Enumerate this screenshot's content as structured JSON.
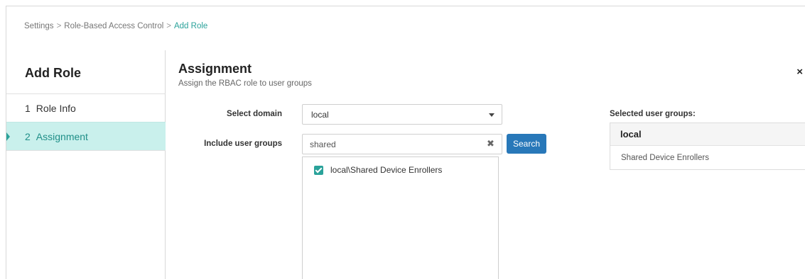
{
  "breadcrumb": {
    "items": [
      "Settings",
      "Role-Based Access Control"
    ],
    "separator": ">",
    "current": "Add Role"
  },
  "sidebar": {
    "title": "Add Role",
    "steps": [
      {
        "number": "1",
        "label": "Role Info",
        "active": false
      },
      {
        "number": "2",
        "label": "Assignment",
        "active": true
      }
    ]
  },
  "main": {
    "title": "Assignment",
    "subtitle": "Assign the RBAC role to user groups",
    "close_icon": "×"
  },
  "form": {
    "domain_label": "Select domain",
    "domain_value": "local",
    "groups_label": "Include user groups",
    "groups_value": "shared",
    "search_label": "Search",
    "clear_icon": "✖"
  },
  "results": {
    "items": [
      {
        "label": "local\\Shared Device Enrollers",
        "checked": true
      }
    ]
  },
  "selected": {
    "title": "Selected user groups:",
    "domain": "local",
    "items": [
      "Shared Device Enrollers"
    ]
  },
  "colors": {
    "accent": "#2aa29a",
    "active_bg": "#c9f0ec",
    "button": "#2878b9"
  }
}
